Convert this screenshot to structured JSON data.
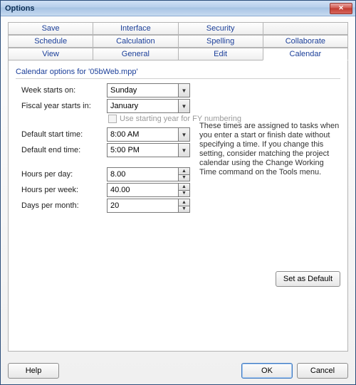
{
  "window": {
    "title": "Options"
  },
  "tabs": {
    "row1": [
      "Save",
      "Interface",
      "Security",
      ""
    ],
    "row2": [
      "Schedule",
      "Calculation",
      "Spelling",
      "Collaborate"
    ],
    "row3": [
      "View",
      "General",
      "Edit",
      "Calendar"
    ],
    "active": "Calendar"
  },
  "group": {
    "title": "Calendar options for '05bWeb.mpp'"
  },
  "labels": {
    "week_starts": "Week starts on:",
    "fiscal_starts": "Fiscal year starts in:",
    "use_starting_year": "Use starting year for FY numbering",
    "default_start": "Default start time:",
    "default_end": "Default end time:",
    "hours_day": "Hours per day:",
    "hours_week": "Hours per week:",
    "days_month": "Days per month:"
  },
  "values": {
    "week_starts": "Sunday",
    "fiscal_starts": "January",
    "default_start": "8:00 AM",
    "default_end": "5:00 PM",
    "hours_day": "8.00",
    "hours_week": "40.00",
    "days_month": "20"
  },
  "info": "These times are assigned to tasks when you enter a start or finish date without specifying a time. If you change this setting, consider matching the project calendar using the Change Working Time command on the Tools menu.",
  "buttons": {
    "set_default": "Set as Default",
    "help": "Help",
    "ok": "OK",
    "cancel": "Cancel"
  }
}
